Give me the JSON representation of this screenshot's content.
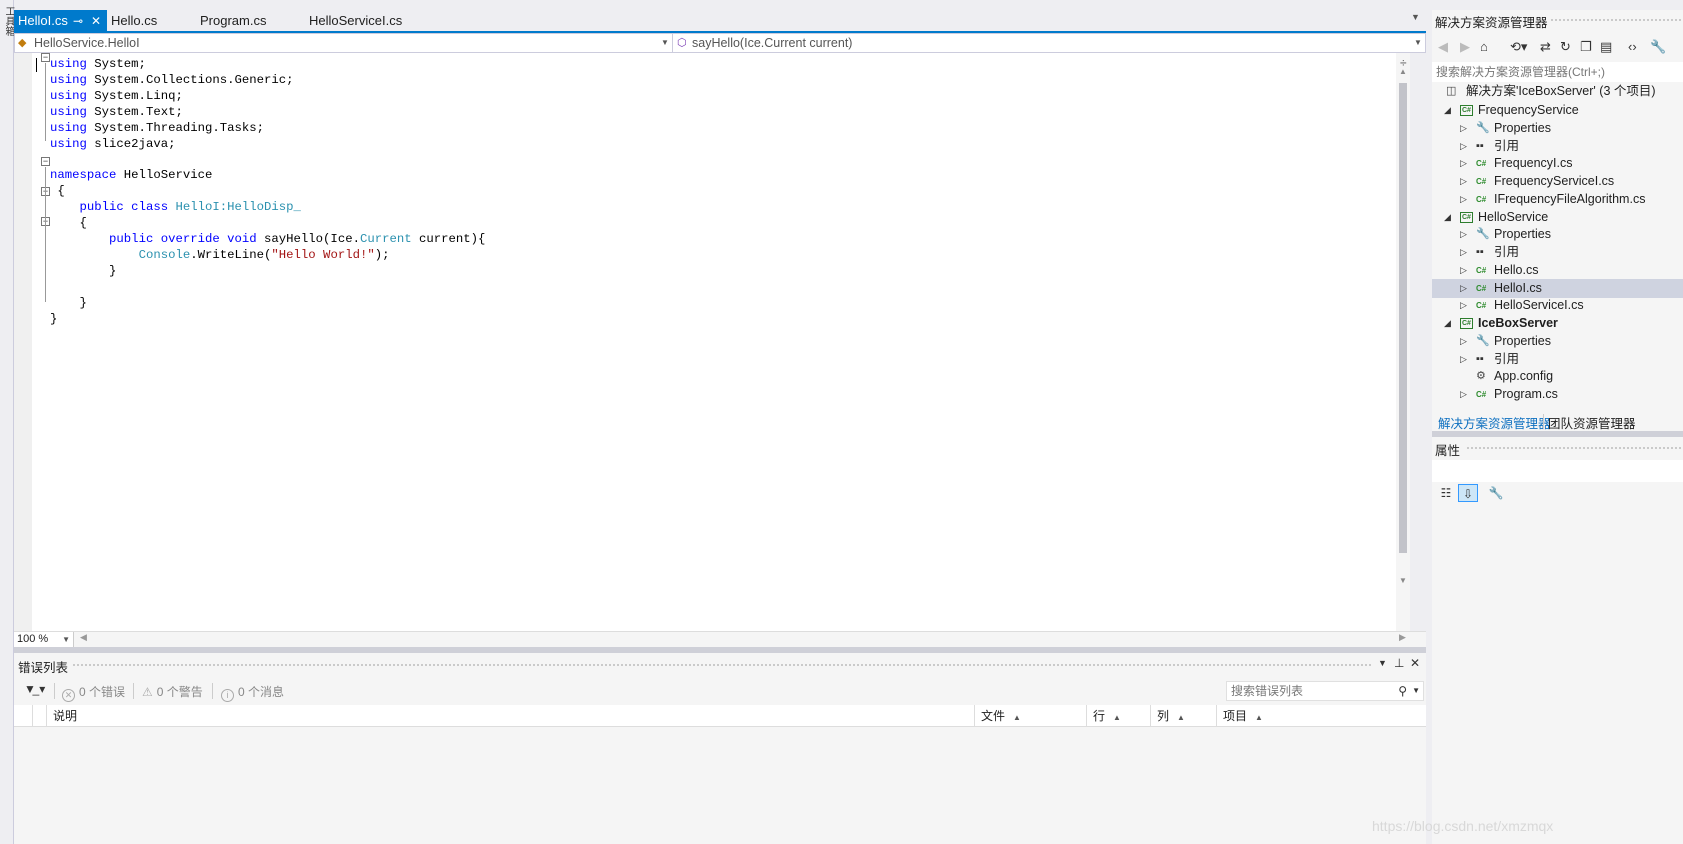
{
  "toolbox": {
    "label": "工具箱"
  },
  "tabs": [
    {
      "label": "HelloI.cs",
      "active": true
    },
    {
      "label": "Hello.cs",
      "active": false
    },
    {
      "label": "Program.cs",
      "active": false
    },
    {
      "label": "HelloServiceI.cs",
      "active": false
    }
  ],
  "navbar": {
    "type_selector": "HelloService.HelloI",
    "member_selector": "sayHello(Ice.Current current)"
  },
  "editor": {
    "zoom": "100 %",
    "code": {
      "l1": [
        "using",
        " System;"
      ],
      "l2": [
        "using",
        " System.Collections.Generic;"
      ],
      "l3": [
        "using",
        " System.Linq;"
      ],
      "l4": [
        "using",
        " System.Text;"
      ],
      "l5": [
        "using",
        " System.Threading.Tasks;"
      ],
      "l6": [
        "using",
        " slice2java;"
      ],
      "l8": [
        "namespace",
        " HelloService"
      ],
      "l9": " {",
      "l10": [
        "public class",
        "HelloI:HelloDisp_"
      ],
      "l11": "{",
      "l12": [
        "public override void",
        " sayHello(Ice.",
        "Current",
        " current){"
      ],
      "l13": [
        "Console",
        ".WriteLine(",
        "\"Hello World!\"",
        ");"
      ],
      "l14": "}",
      "l16": "}",
      "l17": "}"
    }
  },
  "error_list": {
    "title": "错误列表",
    "errors": "0 个错误",
    "warnings": "0 个警告",
    "messages": "0 个消息",
    "search_placeholder": "搜索错误列表",
    "columns": [
      "说明",
      "文件",
      "行",
      "列",
      "项目"
    ]
  },
  "solution_explorer": {
    "title": "解决方案资源管理器",
    "search_placeholder": "搜索解决方案资源管理器(Ctrl+;)",
    "solution": "解决方案'IceBoxServer' (3 个项目)",
    "items": [
      {
        "label": "FrequencyService",
        "kind": "project"
      },
      {
        "label": "Properties",
        "kind": "properties"
      },
      {
        "label": "引用",
        "kind": "references"
      },
      {
        "label": "FrequencyI.cs",
        "kind": "cs"
      },
      {
        "label": "FrequencyServiceI.cs",
        "kind": "cs"
      },
      {
        "label": "IFrequencyFileAlgorithm.cs",
        "kind": "cs"
      },
      {
        "label": "HelloService",
        "kind": "project"
      },
      {
        "label": "Properties",
        "kind": "properties"
      },
      {
        "label": "引用",
        "kind": "references"
      },
      {
        "label": "Hello.cs",
        "kind": "cs"
      },
      {
        "label": "HelloI.cs",
        "kind": "cs",
        "selected": true
      },
      {
        "label": "HelloServiceI.cs",
        "kind": "cs"
      },
      {
        "label": "IceBoxServer",
        "kind": "project",
        "bold": true
      },
      {
        "label": "Properties",
        "kind": "properties"
      },
      {
        "label": "引用",
        "kind": "references"
      },
      {
        "label": "App.config",
        "kind": "config"
      },
      {
        "label": "Program.cs",
        "kind": "cs"
      }
    ],
    "bottom_tabs": [
      "解决方案资源管理器",
      "团队资源管理器"
    ]
  },
  "properties": {
    "title": "属性"
  },
  "watermark": "https://blog.csdn.net/xmzmqx",
  "colors": {
    "accent": "#007acc",
    "keyword": "#0000ff",
    "type": "#2b91af",
    "string": "#a31515",
    "selection": "#cfd3e0"
  }
}
